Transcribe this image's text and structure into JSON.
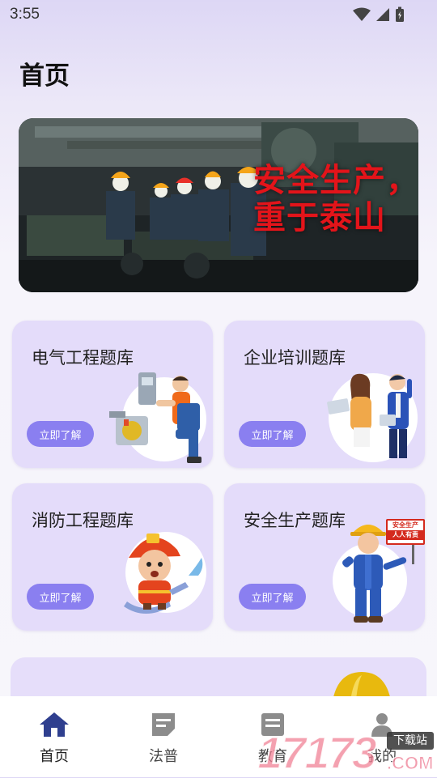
{
  "status": {
    "time": "3:55"
  },
  "page": {
    "title": "首页"
  },
  "banner": {
    "line1": "安全生产，",
    "line2": "重于泰山"
  },
  "cards": [
    {
      "title": "电气工程题库",
      "button": "立即了解"
    },
    {
      "title": "企业培训题库",
      "button": "立即了解"
    },
    {
      "title": "消防工程题库",
      "button": "立即了解"
    },
    {
      "title": "安全生产题库",
      "button": "立即了解"
    }
  ],
  "sign_text": {
    "line1": "安全生产",
    "line2": "人人有责"
  },
  "tabs": [
    {
      "label": "首页",
      "icon": "home-icon",
      "active": true
    },
    {
      "label": "法普",
      "icon": "document-icon",
      "active": false
    },
    {
      "label": "教育",
      "icon": "education-icon",
      "active": false
    },
    {
      "label": "我的",
      "icon": "profile-icon",
      "active": false
    }
  ],
  "watermark": {
    "brand": "17173",
    "badge": "下载站",
    "suffix": ".COM"
  },
  "colors": {
    "accent": "#8a7ff0",
    "card_bg": "#e4dcfa",
    "tab_active": "#2f3f8f",
    "banner_text": "#e3141a"
  }
}
